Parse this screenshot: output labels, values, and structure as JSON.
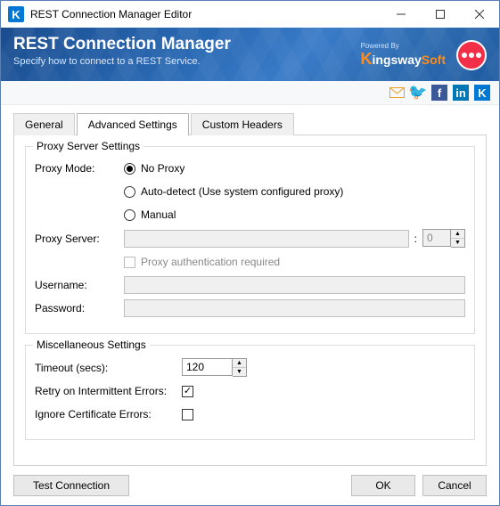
{
  "window": {
    "title": "REST Connection Manager Editor"
  },
  "banner": {
    "title": "REST Connection Manager",
    "subtitle": "Specify how to connect to a REST Service.",
    "poweredBy": "Powered By",
    "brand": {
      "k": "K",
      "rest": "ingsway",
      "orange": "Soft"
    }
  },
  "tabs": {
    "general": "General",
    "advanced": "Advanced Settings",
    "custom": "Custom Headers"
  },
  "proxy": {
    "legend": "Proxy Server Settings",
    "modeLabel": "Proxy Mode:",
    "options": {
      "noProxy": "No Proxy",
      "autoDetect": "Auto-detect (Use system configured proxy)",
      "manual": "Manual"
    },
    "serverLabel": "Proxy Server:",
    "serverValue": "",
    "portValue": "0",
    "authRequired": "Proxy authentication required",
    "usernameLabel": "Username:",
    "usernameValue": "",
    "passwordLabel": "Password:",
    "passwordValue": ""
  },
  "misc": {
    "legend": "Miscellaneous Settings",
    "timeoutLabel": "Timeout (secs):",
    "timeoutValue": "120",
    "retryLabel": "Retry on Intermittent Errors:",
    "ignoreCertLabel": "Ignore Certificate Errors:"
  },
  "footer": {
    "test": "Test Connection",
    "ok": "OK",
    "cancel": "Cancel"
  }
}
